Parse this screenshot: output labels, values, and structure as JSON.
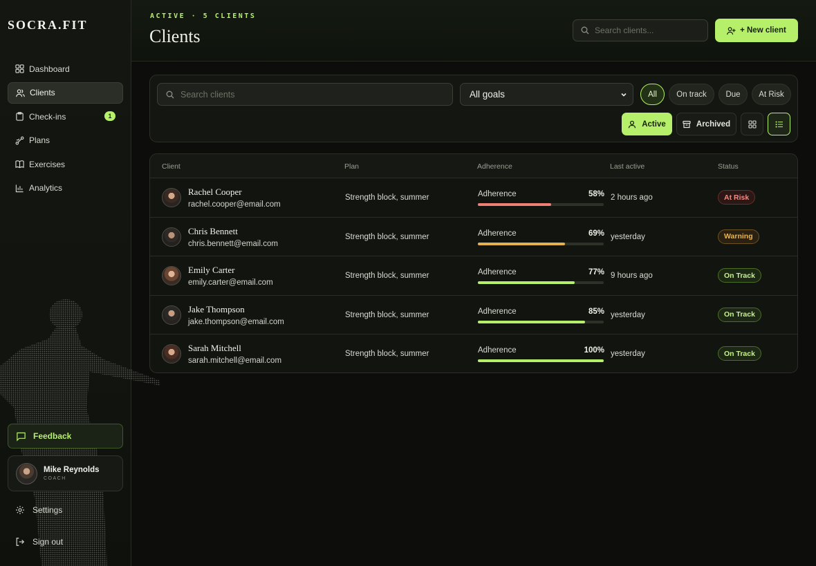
{
  "app": {
    "logo": "SOCRA.FIT"
  },
  "sidebar": {
    "items": [
      {
        "label": "Dashboard",
        "icon": "dashboard-icon"
      },
      {
        "label": "Clients",
        "icon": "users-icon",
        "active": true
      },
      {
        "label": "Check-ins",
        "icon": "clipboard-icon",
        "badge": "1"
      },
      {
        "label": "Plans",
        "icon": "route-icon"
      },
      {
        "label": "Exercises",
        "icon": "book-icon"
      },
      {
        "label": "Analytics",
        "icon": "bar-chart-icon"
      }
    ],
    "feedback": "Feedback",
    "coach": {
      "name": "Mike Reynolds",
      "role": "COACH"
    },
    "settings": "Settings",
    "signout": "Sign out"
  },
  "header": {
    "eyebrow": "ACTIVE · 5 CLIENTS",
    "title": "Clients",
    "search_placeholder": "Search clients...",
    "new_client": "+ New client"
  },
  "filters": {
    "search_placeholder": "Search clients",
    "goal": "All goals",
    "status_pills": [
      "All",
      "On track",
      "Due",
      "At Risk"
    ],
    "active_pill": "All",
    "active_btn": "Active",
    "archived_btn": "Archived"
  },
  "table": {
    "columns": [
      "Client",
      "Plan",
      "Adherence",
      "Last active",
      "Status"
    ],
    "rows": [
      {
        "name": "Rachel Cooper",
        "email": "rachel.cooper@email.com",
        "plan": "Strength block, summer",
        "adherence_label": "Adherence",
        "adherence": 58,
        "adherence_text": "58%",
        "last_active": "2 hours ago",
        "status": "At Risk",
        "status_kind": "risk",
        "bar_color": "#f07f77"
      },
      {
        "name": "Chris Bennett",
        "email": "chris.bennett@email.com",
        "plan": "Strength block, summer",
        "adherence_label": "Adherence",
        "adherence": 69,
        "adherence_text": "69%",
        "last_active": "yesterday",
        "status": "Warning",
        "status_kind": "warn",
        "bar_color": "#e3b24e"
      },
      {
        "name": "Emily Carter",
        "email": "emily.carter@email.com",
        "plan": "Strength block, summer",
        "adherence_label": "Adherence",
        "adherence": 77,
        "adherence_text": "77%",
        "last_active": "9 hours ago",
        "status": "On Track",
        "status_kind": "ok",
        "bar_color": "#b6f06a"
      },
      {
        "name": "Jake Thompson",
        "email": "jake.thompson@email.com",
        "plan": "Strength block, summer",
        "adherence_label": "Adherence",
        "adherence": 85,
        "adherence_text": "85%",
        "last_active": "yesterday",
        "status": "On Track",
        "status_kind": "ok",
        "bar_color": "#b6f06a"
      },
      {
        "name": "Sarah Mitchell",
        "email": "sarah.mitchell@email.com",
        "plan": "Strength block, summer",
        "adherence_label": "Adherence",
        "adherence": 100,
        "adherence_text": "100%",
        "last_active": "yesterday",
        "status": "On Track",
        "status_kind": "ok",
        "bar_color": "#b6f06a"
      }
    ]
  },
  "colors": {
    "accent": "#b6f06a",
    "background": "#0d0e0b",
    "risk": "#f07f77",
    "warning": "#e3b24e"
  }
}
